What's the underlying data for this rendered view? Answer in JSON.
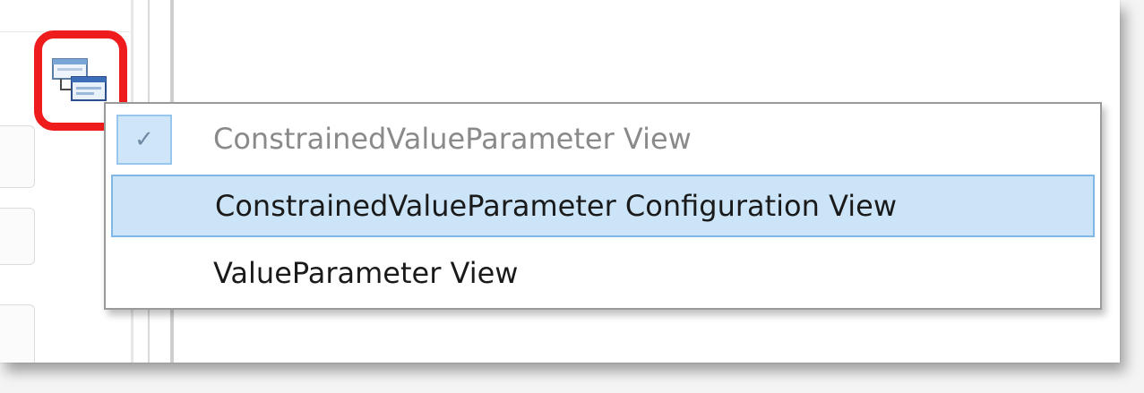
{
  "menu": {
    "items": [
      {
        "label": "ConstrainedValueParameter View",
        "checked": true,
        "state": "disabled"
      },
      {
        "label": "ConstrainedValueParameter Configuration View",
        "checked": false,
        "state": "hover"
      },
      {
        "label": "ValueParameter View",
        "checked": false,
        "state": "normal"
      }
    ],
    "check_glyph": "✓"
  },
  "icons": {
    "view_switcher": "window-switch-icon",
    "check": "check-icon"
  },
  "colors": {
    "highlight_ring": "#ee1c1c",
    "hover_fill": "#cce4f7",
    "hover_border": "#7fb8e6",
    "disabled_text": "#8a8a8a"
  }
}
